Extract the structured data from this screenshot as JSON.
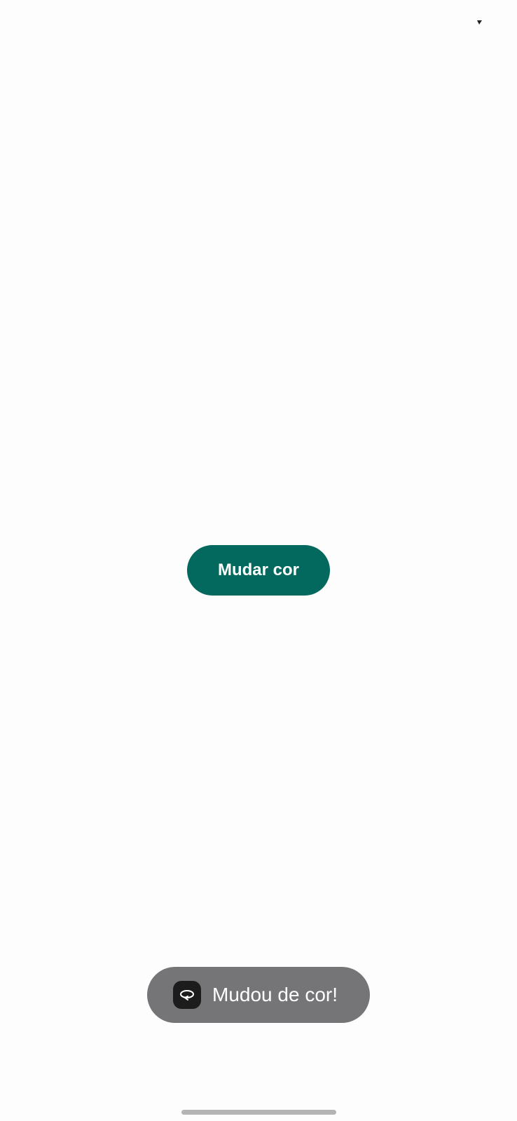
{
  "main": {
    "button_label": "Mudar cor"
  },
  "toast": {
    "message": "Mudou de cor!",
    "icon": "rotate-arrow-icon"
  },
  "status_bar": {
    "indicator_icon": "signal-arrow-icon"
  },
  "colors": {
    "background": "#fdfdfd",
    "button": "#03695f",
    "toast_background": "#757577",
    "toast_icon_background": "#1c1c1c",
    "home_indicator": "#b4b4b4"
  }
}
